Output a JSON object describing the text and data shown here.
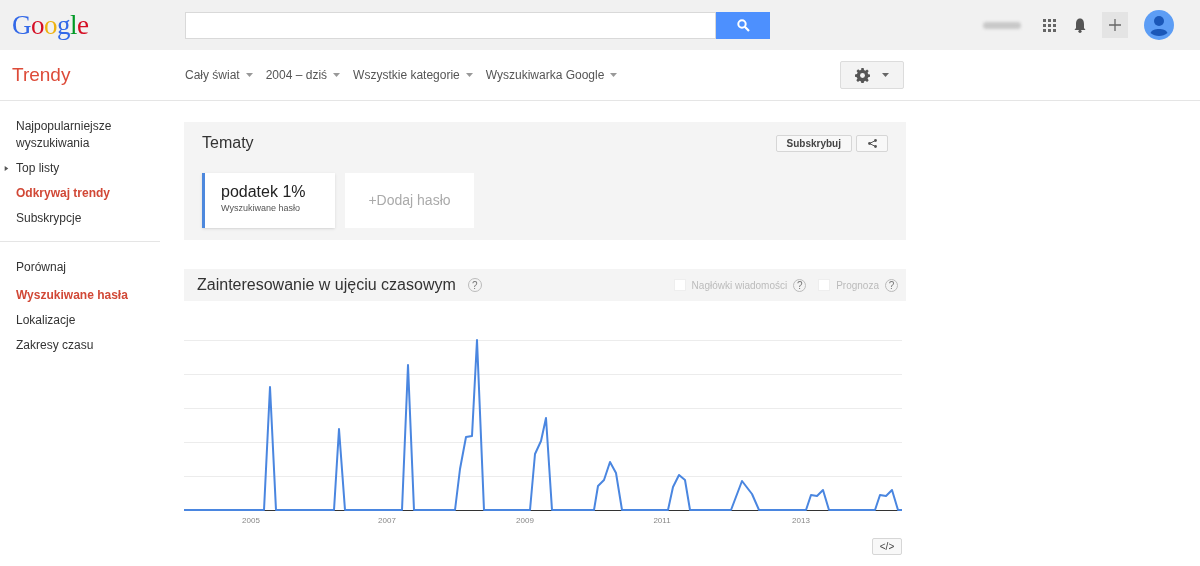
{
  "header": {
    "logo": "Google"
  },
  "app_bar": {
    "title": "Trendy",
    "filters": [
      "Cały świat",
      "2004 – dziś",
      "Wszystkie kategorie",
      "Wyszukiwarka Google"
    ]
  },
  "sidebar": {
    "sections": [
      {
        "items": [
          {
            "label": "Najpopularniejsze wyszukiwania",
            "kind": "link",
            "selected": false
          },
          {
            "label": "Top listy",
            "kind": "expander",
            "expanded": false,
            "selected": false
          },
          {
            "label": "Odkrywaj trendy",
            "kind": "link",
            "selected": true
          },
          {
            "label": "Subskrypcje",
            "kind": "link",
            "selected": false
          }
        ]
      },
      {
        "heading": "Porównaj",
        "items": [
          {
            "label": "Wyszukiwane hasła",
            "kind": "link",
            "selected": true
          },
          {
            "label": "Lokalizacje",
            "kind": "link",
            "selected": false
          },
          {
            "label": "Zakresy czasu",
            "kind": "link",
            "selected": false
          }
        ]
      }
    ]
  },
  "topics": {
    "title": "Tematy",
    "subscribe_button": "Subskrybuj",
    "terms": [
      {
        "term": "podatek 1%",
        "type": "Wyszukiwane hasło",
        "color": "#4d88dd"
      }
    ],
    "add_term": "+Dodaj hasło"
  },
  "interest": {
    "title": "Zainteresowanie w ujęciu czasowym",
    "title_help": "?",
    "options": [
      {
        "label": "Nagłówki wiadomości",
        "checked": false,
        "help": "?"
      },
      {
        "label": "Prognoza",
        "checked": false,
        "help": "?"
      }
    ],
    "chart_axis_labels": [
      "2005",
      "2007",
      "2009",
      "2011",
      "2013"
    ],
    "embed_button": "</>"
  }
}
